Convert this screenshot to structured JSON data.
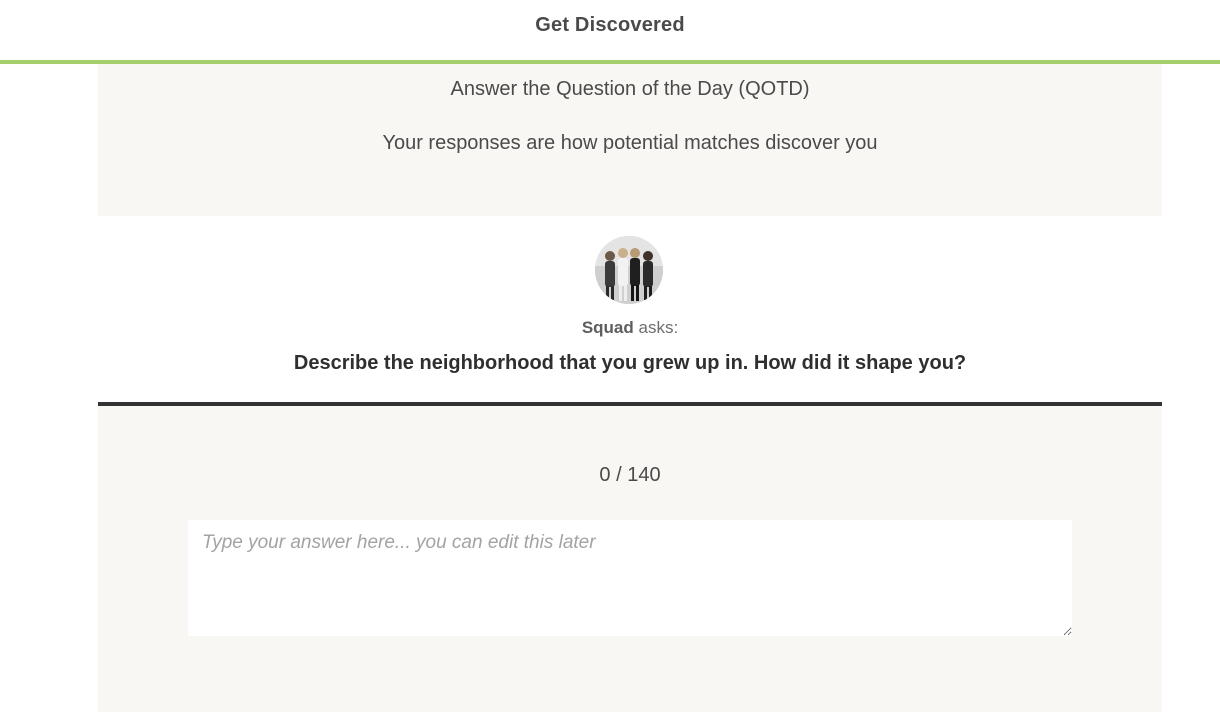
{
  "header": {
    "title": "Get Discovered",
    "accent_color": "#a4cf6a"
  },
  "intro": {
    "heading": "Answer the Question of the Day (QOTD)",
    "subheading": "Your responses are how potential matches discover you"
  },
  "question": {
    "asker_name": "Squad",
    "asker_suffix": " asks:",
    "text": "Describe the neighborhood that you grew up in. How did it shape you?",
    "avatar_icon": "group-photo-avatar"
  },
  "answer": {
    "counter": "0 / 140",
    "value": "",
    "placeholder": "Type your answer here... you can edit this later"
  }
}
